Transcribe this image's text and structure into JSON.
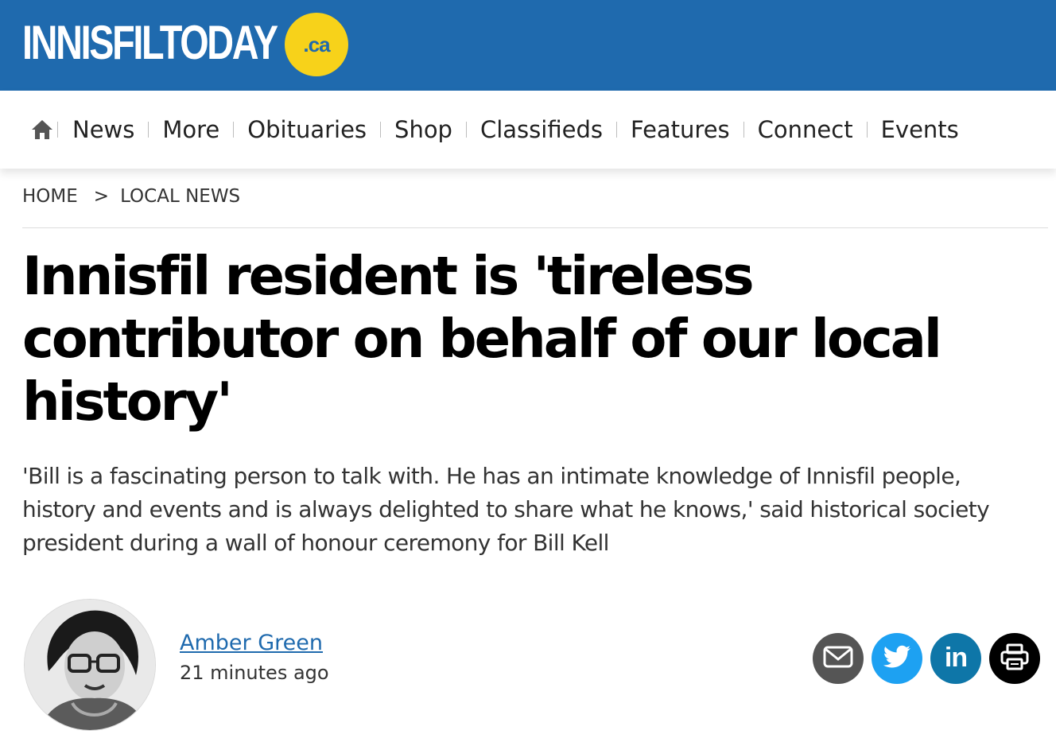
{
  "site": {
    "logo_text": "INNISFILTODAY",
    "logo_badge": ".ca",
    "colors": {
      "brand_blue": "#1f6aae",
      "badge_yellow": "#f7d21a",
      "link_blue": "#1f6aae"
    }
  },
  "nav": {
    "home_icon": "home-icon",
    "items": [
      "News",
      "More",
      "Obituaries",
      "Shop",
      "Classifieds",
      "Features",
      "Connect",
      "Events"
    ]
  },
  "breadcrumb": {
    "home": "HOME",
    "separator": ">",
    "section": "LOCAL NEWS"
  },
  "article": {
    "headline_lines": [
      "Innisfil resident is 'tireless",
      "contributor on behalf of our local",
      "history'"
    ],
    "dek_lines": [
      "'Bill is a fascinating person to talk with. He has an intimate knowledge of Innisfil people,",
      "history and events and is always delighted to share what he knows,' said historical society",
      "president during a wall of honour ceremony for Bill Kell"
    ],
    "author": "Amber Green",
    "timestamp": "21 minutes ago"
  },
  "share": {
    "buttons": [
      "email-icon",
      "twitter-icon",
      "linkedin-icon",
      "print-icon"
    ],
    "linkedin_text": "in",
    "colors": {
      "email": "#555555",
      "twitter": "#1da1f2",
      "linkedin": "#0e76a8",
      "print": "#000000"
    }
  }
}
